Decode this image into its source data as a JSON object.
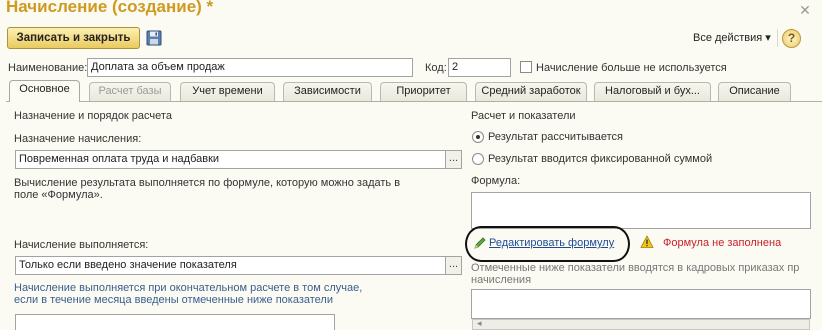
{
  "window": {
    "title": "Начисление (создание) *"
  },
  "toolbar": {
    "save_close_label": "Записать и закрыть",
    "all_actions_label": "Все действия",
    "help_label": "?"
  },
  "header": {
    "name_label": "Наименование:",
    "name_value": "Доплата за объем продаж",
    "code_label": "Код:",
    "code_value": "2",
    "not_used_label": "Начисление больше не используется"
  },
  "tabs": [
    {
      "label": "Основное",
      "state": "active"
    },
    {
      "label": "Расчет базы",
      "state": "disabled"
    },
    {
      "label": "Учет времени",
      "state": "normal"
    },
    {
      "label": "Зависимости",
      "state": "normal"
    },
    {
      "label": "Приоритет",
      "state": "normal"
    },
    {
      "label": "Средний заработок",
      "state": "normal"
    },
    {
      "label": "Налоговый и бух...",
      "state": "normal"
    },
    {
      "label": "Описание",
      "state": "normal"
    }
  ],
  "left": {
    "section_title": "Назначение и порядок расчета",
    "purpose_label": "Назначение начисления:",
    "purpose_value": "Повременная оплата труда и надбавки",
    "calc_note_line1": "Вычисление результата выполняется по формуле, которую можно задать в",
    "calc_note_line2": "поле «Формула».",
    "performed_label": "Начисление выполняется:",
    "performed_value": "Только если введено значение показателя",
    "performed_note_line1": "Начисление выполняется при окончательном расчете в том случае,",
    "performed_note_line2": "если в течение месяца введены отмеченные ниже показатели"
  },
  "right": {
    "section_title": "Расчет и показатели",
    "radio_calculated": "Результат рассчитывается",
    "radio_fixed": "Результат вводится фиксированной суммой",
    "formula_label": "Формула:",
    "edit_formula_link": "Редактировать формулу",
    "formula_warning": "Формула не заполнена",
    "indicators_note_line1": "Отмеченные ниже показатели вводятся в кадровых приказах пр",
    "indicators_note_line2": "начисления"
  },
  "colors": {
    "title": "#cf9a22",
    "link": "#1e4d95",
    "warning": "#c8202a",
    "note_blue": "#3a5e8f"
  },
  "icons": {
    "save": "floppy-disk-icon",
    "help": "help-icon",
    "edit": "pencil-icon",
    "warning": "warning-triangle-icon",
    "close": "close-icon"
  }
}
